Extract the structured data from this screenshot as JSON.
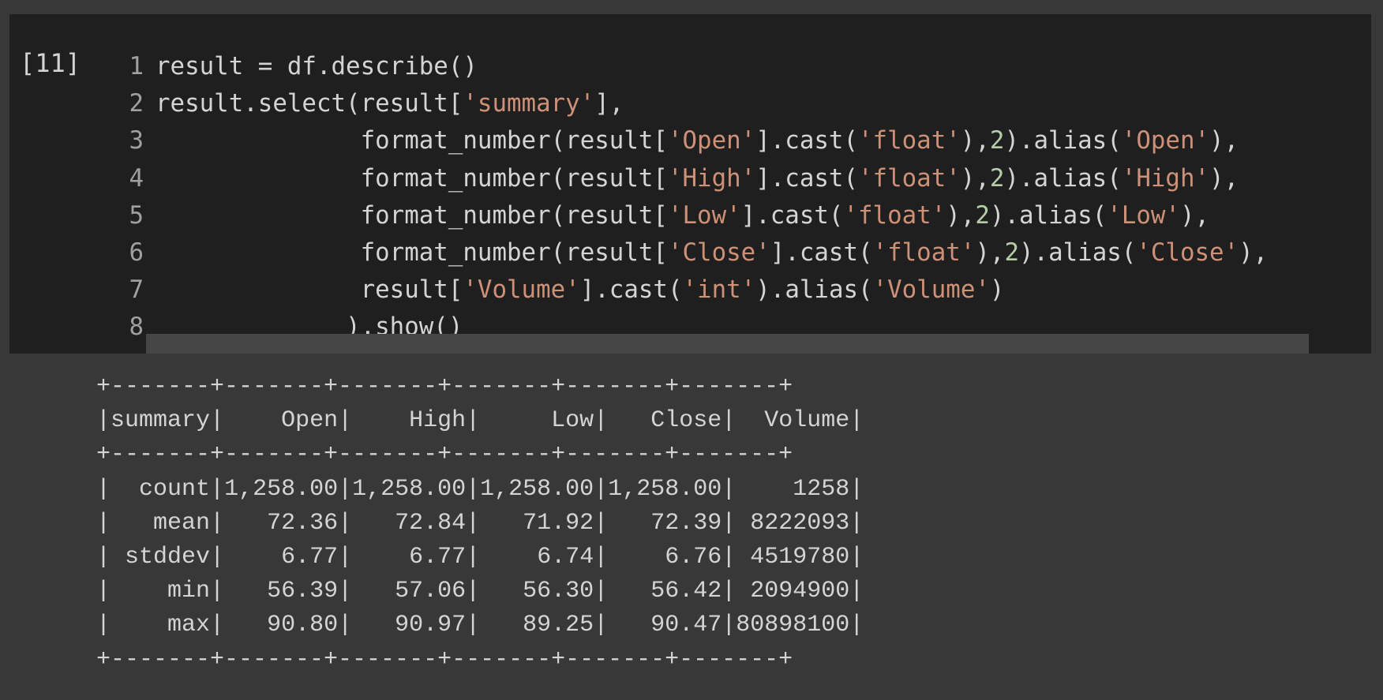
{
  "cell": {
    "execution_count": "[11]",
    "code_lines": [
      {
        "number": "1",
        "tokens": [
          {
            "t": "result = df.describe()",
            "k": "plain"
          }
        ]
      },
      {
        "number": "2",
        "tokens": [
          {
            "t": "result.select(result[",
            "k": "plain"
          },
          {
            "t": "'summary'",
            "k": "str"
          },
          {
            "t": "],",
            "k": "plain"
          }
        ]
      },
      {
        "number": "3",
        "tokens": [
          {
            "t": "              format_number(result[",
            "k": "plain"
          },
          {
            "t": "'Open'",
            "k": "str"
          },
          {
            "t": "].cast(",
            "k": "plain"
          },
          {
            "t": "'float'",
            "k": "str"
          },
          {
            "t": "),",
            "k": "plain"
          },
          {
            "t": "2",
            "k": "num"
          },
          {
            "t": ").alias(",
            "k": "plain"
          },
          {
            "t": "'Open'",
            "k": "str"
          },
          {
            "t": "),",
            "k": "plain"
          }
        ]
      },
      {
        "number": "4",
        "tokens": [
          {
            "t": "              format_number(result[",
            "k": "plain"
          },
          {
            "t": "'High'",
            "k": "str"
          },
          {
            "t": "].cast(",
            "k": "plain"
          },
          {
            "t": "'float'",
            "k": "str"
          },
          {
            "t": "),",
            "k": "plain"
          },
          {
            "t": "2",
            "k": "num"
          },
          {
            "t": ").alias(",
            "k": "plain"
          },
          {
            "t": "'High'",
            "k": "str"
          },
          {
            "t": "),",
            "k": "plain"
          }
        ]
      },
      {
        "number": "5",
        "tokens": [
          {
            "t": "              format_number(result[",
            "k": "plain"
          },
          {
            "t": "'Low'",
            "k": "str"
          },
          {
            "t": "].cast(",
            "k": "plain"
          },
          {
            "t": "'float'",
            "k": "str"
          },
          {
            "t": "),",
            "k": "plain"
          },
          {
            "t": "2",
            "k": "num"
          },
          {
            "t": ").alias(",
            "k": "plain"
          },
          {
            "t": "'Low'",
            "k": "str"
          },
          {
            "t": "),",
            "k": "plain"
          }
        ]
      },
      {
        "number": "6",
        "tokens": [
          {
            "t": "              format_number(result[",
            "k": "plain"
          },
          {
            "t": "'Close'",
            "k": "str"
          },
          {
            "t": "].cast(",
            "k": "plain"
          },
          {
            "t": "'float'",
            "k": "str"
          },
          {
            "t": "),",
            "k": "plain"
          },
          {
            "t": "2",
            "k": "num"
          },
          {
            "t": ").alias(",
            "k": "plain"
          },
          {
            "t": "'Close'",
            "k": "str"
          },
          {
            "t": "),",
            "k": "plain"
          }
        ]
      },
      {
        "number": "7",
        "tokens": [
          {
            "t": "              result[",
            "k": "plain"
          },
          {
            "t": "'Volume'",
            "k": "str"
          },
          {
            "t": "].cast(",
            "k": "plain"
          },
          {
            "t": "'int'",
            "k": "str"
          },
          {
            "t": ").alias(",
            "k": "plain"
          },
          {
            "t": "'Volume'",
            "k": "str"
          },
          {
            "t": ")",
            "k": "plain"
          }
        ]
      },
      {
        "number": "8",
        "tokens": [
          {
            "t": "             ).show()",
            "k": "plain"
          }
        ]
      }
    ]
  },
  "output": {
    "columns": [
      "summary",
      "Open",
      "High",
      "Low",
      "Close",
      "Volume"
    ],
    "rows": [
      [
        "count",
        "1,258.00",
        "1,258.00",
        "1,258.00",
        "1,258.00",
        "1258"
      ],
      [
        "mean",
        "72.36",
        "72.84",
        "71.92",
        "72.39",
        "8222093"
      ],
      [
        "stddev",
        "6.77",
        "6.77",
        "6.74",
        "6.76",
        "4519780"
      ],
      [
        "min",
        "56.39",
        "57.06",
        "56.30",
        "56.42",
        "2094900"
      ],
      [
        "max",
        "90.80",
        "90.97",
        "89.25",
        "90.47",
        "80898100"
      ]
    ]
  },
  "colors": {
    "page_background": "#383838",
    "cell_background": "#1f1f1f",
    "text": "#d4d4d4",
    "line_number": "#a0a0a0",
    "string": "#ce9178",
    "number": "#b5cea8"
  }
}
